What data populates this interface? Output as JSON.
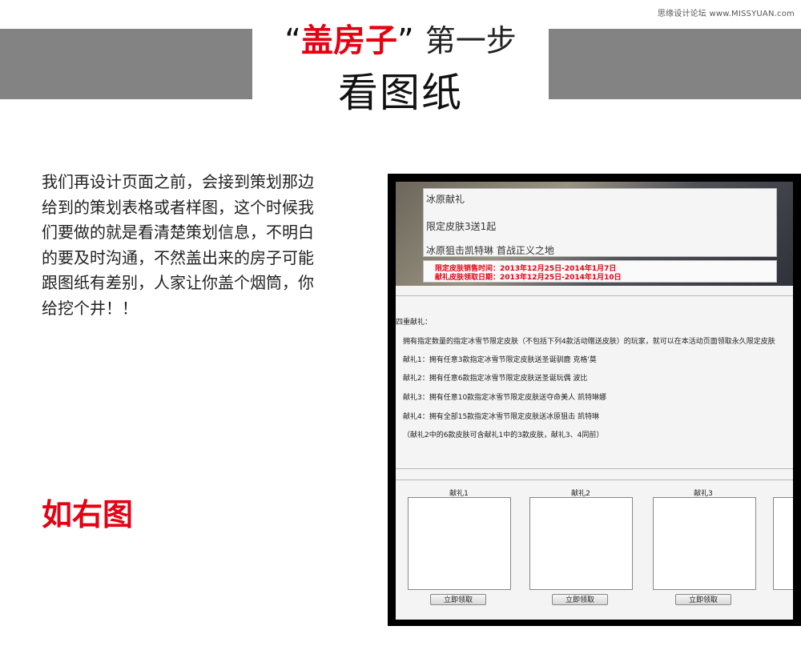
{
  "watermark": "思缘设计论坛 www.MISSYUAN.com",
  "header": {
    "quote_open": "“",
    "highlight": "盖房子",
    "quote_close": "”",
    "step": "第一步",
    "subtitle": "看图纸"
  },
  "intro": {
    "lines": [
      "我们再设计页面之前，会接到策划那边",
      "给到的策划表格或者样图，这个时候我",
      "们要做的就是看清楚策划信息，不明白",
      "的要及时沟通，不然盖出来的房子可能",
      "跟图纸有差别，人家让你盖个烟筒，你",
      "给挖个井！！"
    ],
    "see_right": "如右图"
  },
  "mockup": {
    "banner": {
      "title": "冰原献礼",
      "subtitle": "限定皮肤3送1起",
      "slogan": "冰原狙击凯特琳 首战正义之地",
      "sale_time": "限定皮肤销售时间：2013年12月25日-2014年1月7日",
      "claim_time": "献礼皮肤领取日期：2013年12月25日-2014年1月10日"
    },
    "rules": {
      "heading": "四重献礼：",
      "intro": "拥有指定数量的指定冰雪节限定皮肤（不包括下列4款活动赠送皮肤）的玩家，就可以在本活动页面领取永久限定皮肤",
      "gifts": [
        "献礼1：拥有任意3款指定冰雪节限定皮肤送圣诞驯鹿 克格'莫",
        "献礼2：拥有任意6款指定冰雪节限定皮肤送圣诞玩偶 波比",
        "献礼3：拥有任意10款指定冰雪节限定皮肤送夺命美人 凯特琳娜",
        "献礼4：拥有全部15款指定冰雪节限定皮肤送冰原狙击 凯特琳"
      ],
      "note": "（献礼2中的6款皮肤可含献礼1中的3款皮肤，献礼3、4同前）"
    },
    "cards": [
      {
        "label": "献礼1",
        "button": "立即领取"
      },
      {
        "label": "献礼2",
        "button": "立即领取"
      },
      {
        "label": "献礼3",
        "button": "立即领取"
      }
    ]
  }
}
